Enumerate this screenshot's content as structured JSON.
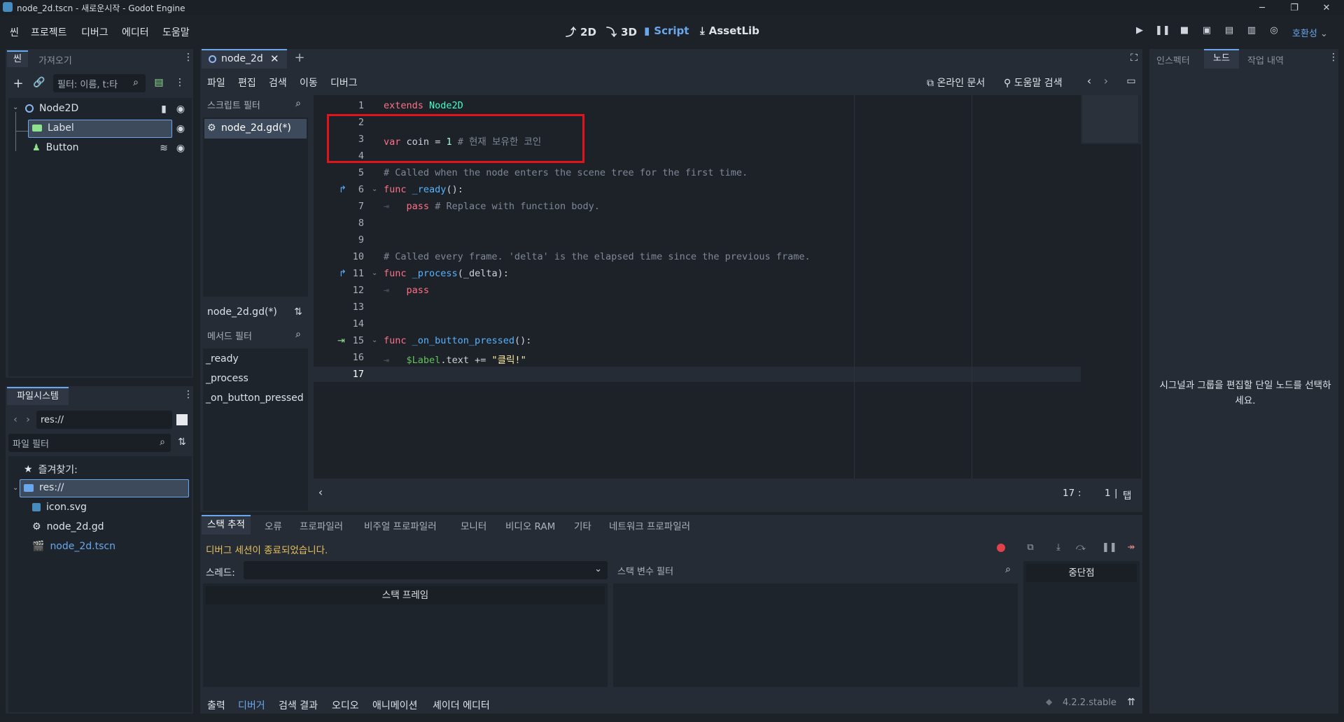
{
  "window": {
    "title": "node_2d.tscn - 새로운시작 - Godot Engine",
    "controls": [
      "─",
      "❐",
      "✕"
    ]
  },
  "menu": {
    "items": [
      "씬",
      "프로젝트",
      "디버그",
      "에디터",
      "도움말"
    ],
    "modes": [
      {
        "label": "2D",
        "icon": "2d-icon"
      },
      {
        "label": "3D",
        "icon": "3d-icon"
      },
      {
        "label": "Script",
        "icon": "script-icon"
      },
      {
        "label": "AssetLib",
        "icon": "assetlib-icon"
      }
    ],
    "renderer": "호환성"
  },
  "scene_dock": {
    "tabs": [
      "씬",
      "가져오기"
    ],
    "filter_placeholder": "필터: 이름, t:타",
    "nodes": [
      {
        "name": "Node2D",
        "icon": "node2d-icon"
      },
      {
        "name": "Label",
        "icon": "label-icon"
      },
      {
        "name": "Button",
        "icon": "button-icon"
      }
    ]
  },
  "filesystem": {
    "title": "파일시스템",
    "path": "res://",
    "filter_placeholder": "파일 필터",
    "favorites": "즐겨찾기:",
    "items": [
      "res://",
      "icon.svg",
      "node_2d.gd",
      "node_2d.tscn"
    ]
  },
  "editor": {
    "tab": "node_2d",
    "menus": [
      "파일",
      "편집",
      "검색",
      "이동",
      "디버그"
    ],
    "online_docs": "온라인 문서",
    "help_search": "도움말 검색",
    "script_filter": "스크립트 필터",
    "scripts": [
      "node_2d.gd(*)"
    ],
    "current_script": "node_2d.gd(*)",
    "method_filter": "메서드 필터",
    "methods": [
      "_ready",
      "_process",
      "_on_button_pressed"
    ],
    "line_numbers": [
      "1",
      "2",
      "3",
      "4",
      "5",
      "6",
      "7",
      "8",
      "9",
      "10",
      "11",
      "12",
      "13",
      "14",
      "15",
      "16",
      "17"
    ],
    "code": {
      "l1_kw": "extends",
      "l1_type": "Node2D",
      "l3_kw": "var",
      "l3_id": "coin",
      "l3_eq": "=",
      "l3_num": "1",
      "l3_comment": "# 현재 보유한 코인",
      "l5_comment": "# Called when the node enters the scene tree for the first time.",
      "l6_kw": "func",
      "l6_fn": "_ready",
      "l6_rest": "():",
      "l7_kw": "pass",
      "l7_comment": "# Replace with function body.",
      "l10_comment": "# Called every frame. 'delta' is the elapsed time since the previous frame.",
      "l11_kw": "func",
      "l11_fn": "_process",
      "l11_rest": "(_delta):",
      "l12_kw": "pass",
      "l15_kw": "func",
      "l15_fn": "_on_button_pressed",
      "l15_rest": "():",
      "l16_node": "$Label",
      "l16_rest": ".text += ",
      "l16_str": "\"클릭!\""
    },
    "status_line": "17",
    "status_col": "1",
    "status_sep": ":",
    "indent_mode": "탭"
  },
  "debugger": {
    "tabs": [
      "스택 추적",
      "오류",
      "프로파일러",
      "비주얼 프로파일러",
      "모니터",
      "비디오 RAM",
      "기타",
      "네트워크 프로파일러"
    ],
    "message": "디버그 세션이 종료되었습니다.",
    "thread_label": "스레드:",
    "stack_frames": "스택 프레임",
    "var_filter": "스택 변수 필터",
    "breakpoints": "중단점"
  },
  "bottom_tabs": [
    "출력",
    "디버거",
    "검색 결과",
    "오디오",
    "애니메이션",
    "셰이더 에디터"
  ],
  "version": "4.2.2.stable",
  "inspector": {
    "tabs": [
      "인스펙터",
      "노드",
      "작업 내역"
    ],
    "message": "시그널과 그룹을 편집할 단일 노드를 선택하세요."
  },
  "colors": {
    "accent": "#6aa7ec",
    "highlight_box": "#e0141a",
    "debug_message": "#e6c05a"
  }
}
